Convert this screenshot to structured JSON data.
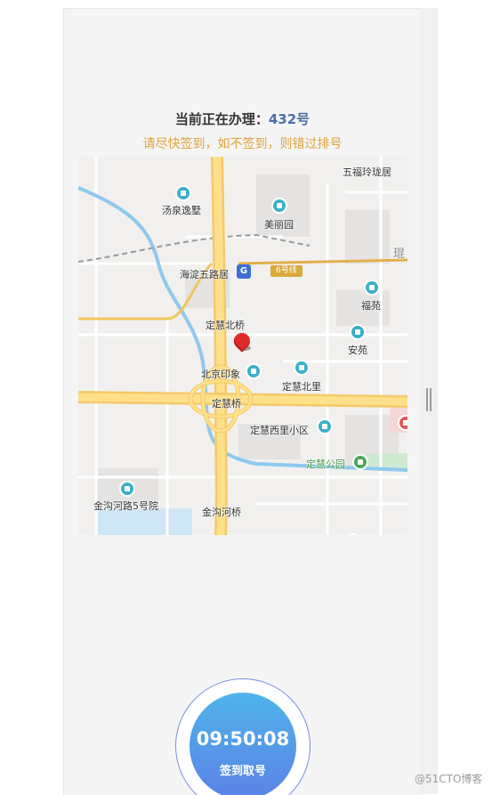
{
  "header": {
    "status_prefix": "当前正在办理：",
    "current_number": "432号",
    "warning": "请尽快签到，如不签到，则错过排号"
  },
  "map": {
    "labels": {
      "wufu_linglong": "五福玲珑居",
      "tangquan": "汤泉逸墅",
      "meili": "美丽园",
      "haidian_wulu": "海淀五路居",
      "line6": "6号线",
      "fuyuan": "福苑",
      "dinghui_beiqiao": "定慧北桥",
      "anyuan": "安苑",
      "beijing_yinxiang": "北京印象",
      "dinghui_beili": "定慧北里",
      "dinghui_qiao": "定慧桥",
      "dinghui_xili": "定慧西里小区",
      "dinghui_park": "定慧公园",
      "jingou_5": "金沟河路5号院",
      "jingou_bridge": "金沟河桥",
      "edge_char": "琨"
    }
  },
  "sign": {
    "time": "09:50:08",
    "label": "签到取号"
  },
  "watermark": "@51CTO博客",
  "colors": {
    "accent_blue": "#4a6fa5",
    "warning_orange": "#e0a23a",
    "button_top": "#4fb4ea",
    "button_bottom": "#5b82e6"
  }
}
